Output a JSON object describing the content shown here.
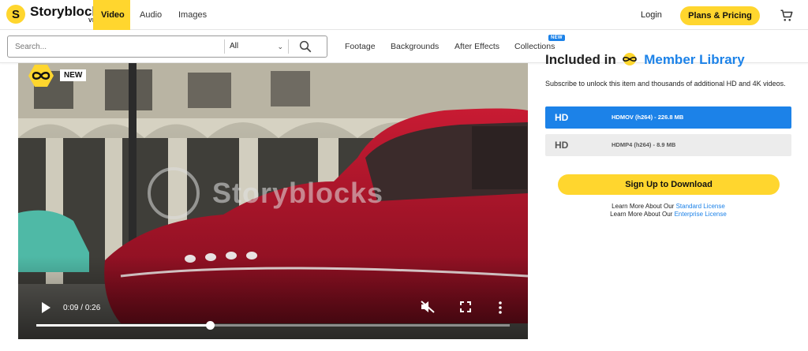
{
  "brand": {
    "name": "Storyblocks",
    "sub": "VIDEO",
    "mark": "S"
  },
  "nav": {
    "tabs": [
      {
        "label": "Video",
        "active": true
      },
      {
        "label": "Audio",
        "active": false
      },
      {
        "label": "Images",
        "active": false
      }
    ],
    "login": "Login",
    "plans": "Plans & Pricing"
  },
  "search": {
    "placeholder": "Search...",
    "category": "All",
    "links": [
      "Footage",
      "Backgrounds",
      "After Effects",
      "Collections"
    ],
    "collections_badge": "NEW"
  },
  "video": {
    "badge": "NEW",
    "watermark": "Storyblocks",
    "current_time": "0:09",
    "duration": "0:26",
    "progress": 0.366
  },
  "panel": {
    "heading_prefix": "Included in",
    "heading_link": "Member Library",
    "description": "Subscribe to unlock this item and thousands of additional HD and 4K videos.",
    "options": [
      {
        "quality": "HD",
        "format": "HDMOV (h264) - 226.8 MB",
        "selected": true
      },
      {
        "quality": "HD",
        "format": "HDMP4 (h264) - 8.9 MB",
        "selected": false
      }
    ],
    "cta": "Sign Up to Download",
    "learn": [
      {
        "prefix": "Learn More About Our",
        "link": "Standard License"
      },
      {
        "prefix": "Learn More About Our",
        "link": "Enterprise License"
      }
    ]
  },
  "colors": {
    "accent": "#ffd62e",
    "blue": "#1c82e8",
    "car_red": "#b3122a"
  }
}
